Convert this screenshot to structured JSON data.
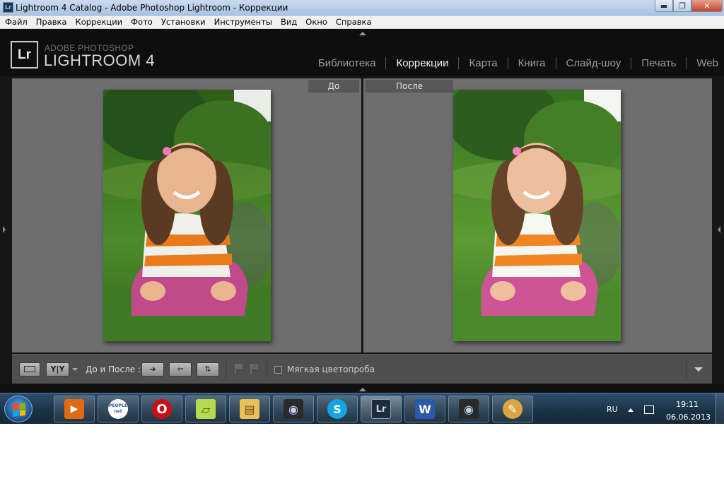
{
  "window": {
    "app_icon_text": "Lr",
    "title": "Lightroom 4 Catalog - Adobe Photoshop Lightroom - Коррекции",
    "minimize_glyph": "▬",
    "restore_glyph": "❐",
    "close_glyph": "✕"
  },
  "menu": [
    "Файл",
    "Правка",
    "Коррекции",
    "Фото",
    "Установки",
    "Инструменты",
    "Вид",
    "Окно",
    "Справка"
  ],
  "brand": {
    "logo": "Lr",
    "small": "ADOBE PHOTOSHOP",
    "big": "LIGHTROOM 4"
  },
  "modules": [
    {
      "label": "Библиотека",
      "active": false
    },
    {
      "label": "Коррекции",
      "active": true
    },
    {
      "label": "Карта",
      "active": false
    },
    {
      "label": "Книга",
      "active": false
    },
    {
      "label": "Слайд-шоу",
      "active": false
    },
    {
      "label": "Печать",
      "active": false
    },
    {
      "label": "Web",
      "active": false
    }
  ],
  "compare": {
    "before_label": "До",
    "after_label": "После"
  },
  "toolbar": {
    "yy_label": "Y|Y",
    "before_after_label": "До и После :",
    "swap_right_glyph": "➜",
    "swap_left_glyph": "⇦",
    "swap_vertical_glyph": "⇅",
    "soft_proof_label": "Мягкая цветопроба"
  },
  "taskbar": {
    "apps": [
      {
        "name": "media-player",
        "glyph": "▶",
        "color": "#e06a12"
      },
      {
        "name": "people-net",
        "glyph": "PEOPLE net",
        "color": "#ffffff"
      },
      {
        "name": "opera",
        "glyph": "O",
        "color": "#cc0f16"
      },
      {
        "name": "sticky-notes",
        "glyph": "▱",
        "color": "#b7d94e"
      },
      {
        "name": "file-explorer",
        "glyph": "▤",
        "color": "#e8c15a"
      },
      {
        "name": "camera-app-1",
        "glyph": "◉",
        "color": "#2a2a2a"
      },
      {
        "name": "skype",
        "glyph": "S",
        "color": "#12a5e3"
      },
      {
        "name": "lightroom",
        "glyph": "Lr",
        "color": "#1d2c3d"
      },
      {
        "name": "word",
        "glyph": "W",
        "color": "#2a5aa9"
      },
      {
        "name": "camera-app-2",
        "glyph": "◉",
        "color": "#2a2a2a"
      },
      {
        "name": "paint",
        "glyph": "✎",
        "color": "#d9a441"
      }
    ],
    "lang": "RU",
    "time": "19:11",
    "date": "06.06.2013"
  }
}
